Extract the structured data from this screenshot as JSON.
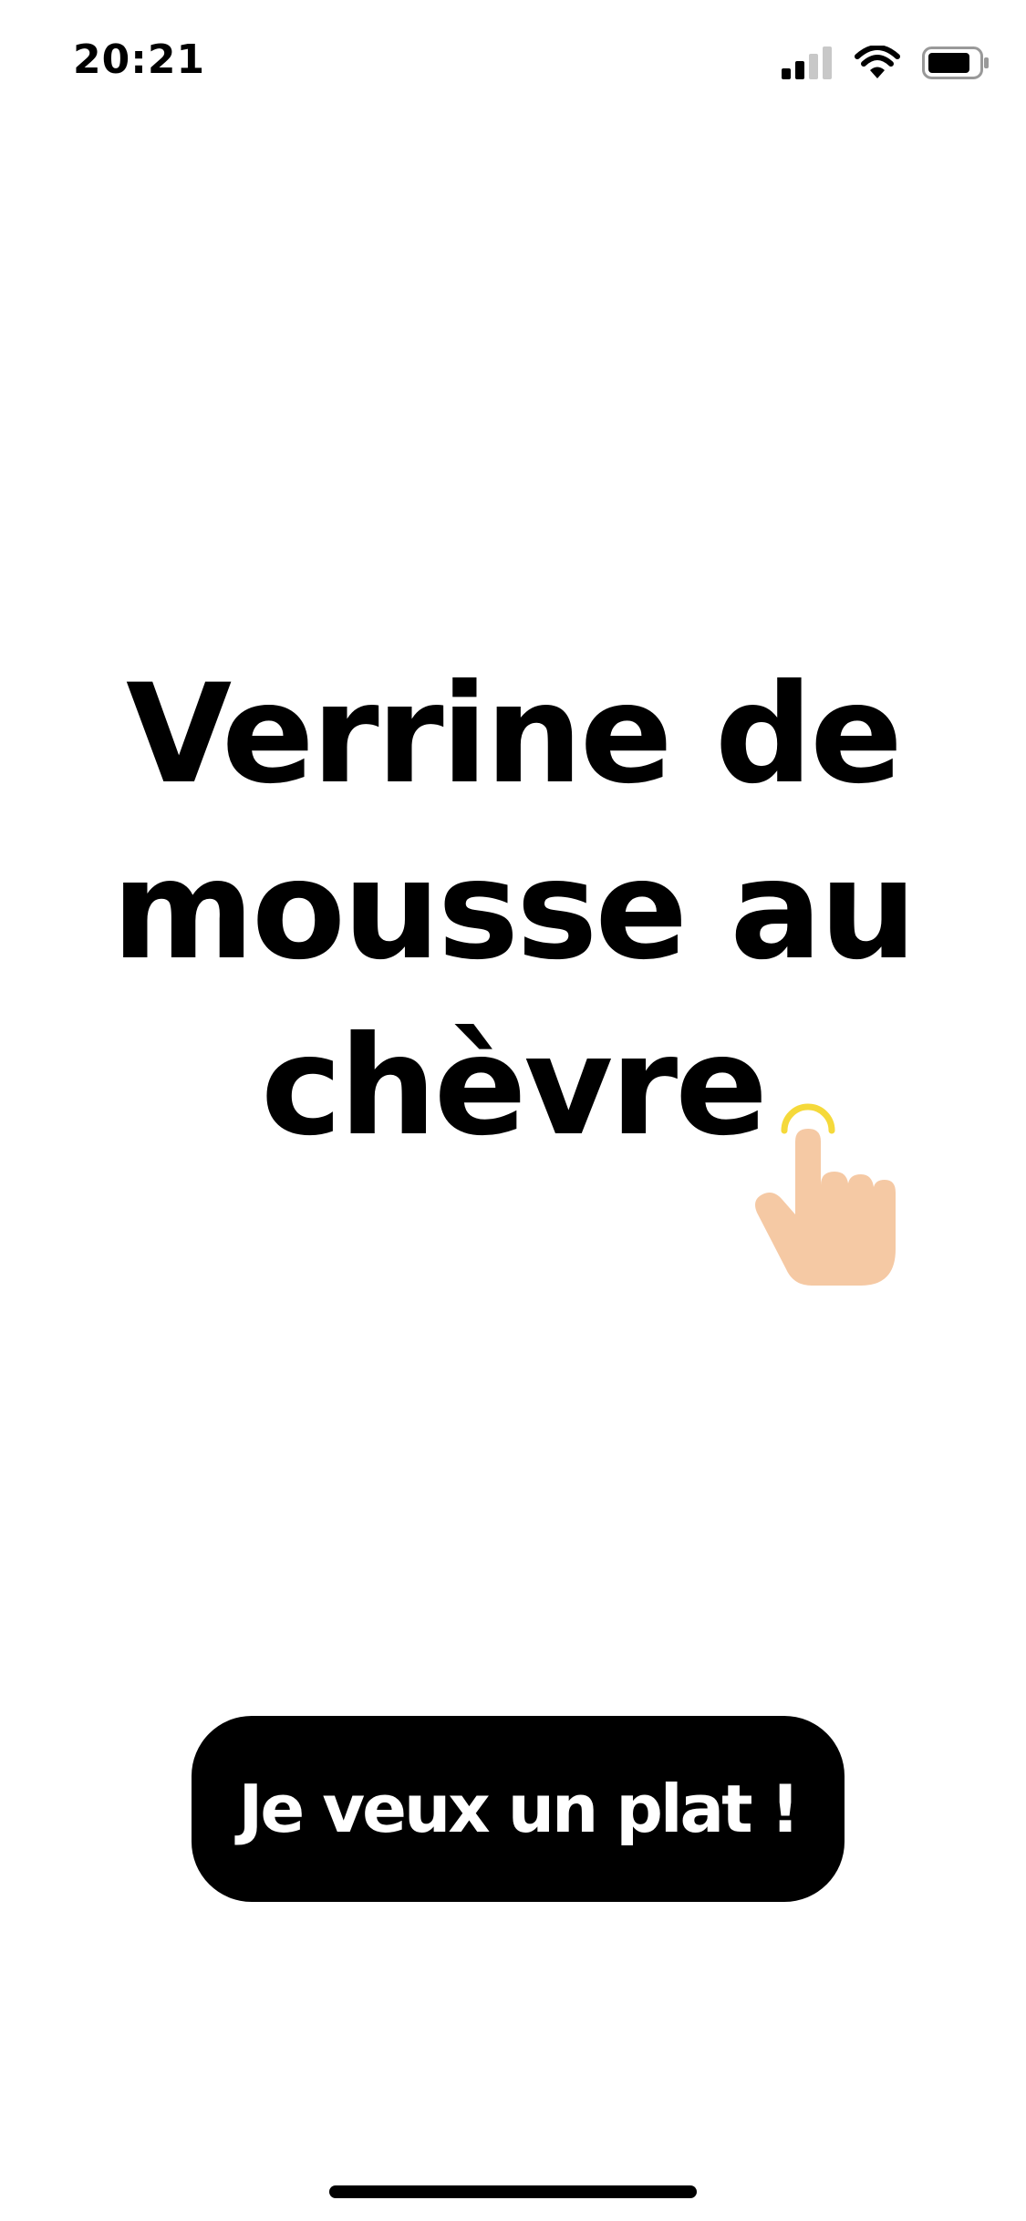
{
  "status_bar": {
    "time": "20:21",
    "icons": [
      "cellular-signal-icon",
      "wifi-icon",
      "battery-icon"
    ]
  },
  "main": {
    "dish_title": "Verrine de mousse au chèvre",
    "tap_hint_icon": "tap-hand-icon"
  },
  "cta": {
    "label": "Je veux un plat !"
  },
  "colors": {
    "background": "#ffffff",
    "text": "#000000",
    "button_bg": "#000000",
    "button_text": "#ffffff",
    "hand_skin": "#F5C9A4",
    "tap_ring": "#F5D93A"
  }
}
